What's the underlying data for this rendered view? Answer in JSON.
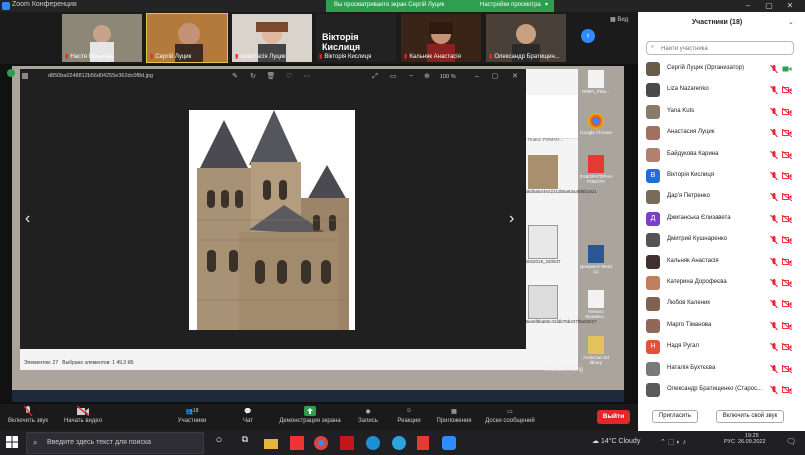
{
  "app": {
    "title": "Zoom Конференция"
  },
  "banner": {
    "viewing": "Вы просматриваете экран Сергій Луцик",
    "options": "Настройки просмотра"
  },
  "thumbnails": [
    {
      "name": "Настя Гуськова"
    },
    {
      "name": "Сергій Луцик"
    },
    {
      "name": "Анастасія Луцик"
    },
    {
      "name": "Вікторія Кислиця",
      "big_label": "Вікторія Кислиця"
    },
    {
      "name": "Кальняк Анастасія"
    },
    {
      "name": "Олександр Братищен..."
    }
  ],
  "view_label": "Вид",
  "photoviewer": {
    "filename": "d850ba0248812b56d04255e362dc0f8d.jpg",
    "zoom": "100 %"
  },
  "explorer": {
    "status_items": "Элементов: 27",
    "status_selected": "Выбрано элементов: 1  49,3 КБ",
    "search_placeholder": "Поиск: РОМАН...",
    "files": [
      {
        "label": "0b63ba524e2221d55a63a48f6b1821"
      },
      {
        "label": "2022019_220047"
      },
      {
        "label": "66a4ef5ba60c41fdb76b437f9a08227"
      }
    ]
  },
  "desktop_icons": [
    {
      "label": "RMIFI_Files..."
    },
    {
      "label": "Google Chrome"
    },
    {
      "label": "ЛАБОРАТОРНА РОБОТА"
    },
    {
      "label": "Документ Word (1)"
    },
    {
      "label": "Начало Маковск..."
    },
    {
      "label": "ArchiCad old library"
    }
  ],
  "bing": "Microsoft Bing",
  "toolbar": {
    "audio": "Включить звук",
    "video": "Начать видео",
    "participants": "Участники",
    "participants_count": "18",
    "chat": "Чат",
    "share": "Демонстрация экрана",
    "record": "Запись",
    "reactions": "Реакции",
    "apps": "Приложения",
    "whiteboard": "Доски сообщений",
    "end": "Выйти"
  },
  "panel": {
    "title": "Участники (18)",
    "search_placeholder": "Найти участника",
    "participants": [
      {
        "name": "Сергій Луцик (Организатор)",
        "initial": "",
        "color": "#6b5b4b"
      },
      {
        "name": "Liza Nazarenko",
        "initial": "",
        "color": "#4a4a4a"
      },
      {
        "name": "Yana Kuts",
        "initial": "",
        "color": "#8a7a6a"
      },
      {
        "name": "Анастасия Луцик",
        "initial": "",
        "color": "#a07060"
      },
      {
        "name": "Байдукова Карина",
        "initial": "",
        "color": "#b08070"
      },
      {
        "name": "Вікторія Кислиця",
        "initial": "В",
        "color": "#1E6FD9"
      },
      {
        "name": "Дар'я Петренко",
        "initial": "",
        "color": "#7a6a5a"
      },
      {
        "name": "Джиганська Єлизавета",
        "initial": "Д",
        "color": "#7B3FC4"
      },
      {
        "name": "Дмитрий Кушнаренко",
        "initial": "",
        "color": "#555"
      },
      {
        "name": "Кальняк Анастасія",
        "initial": "",
        "color": "#403030"
      },
      {
        "name": "Катерина Дорофеєва",
        "initial": "",
        "color": "#c08060"
      },
      {
        "name": "Любов Каленик",
        "initial": "",
        "color": "#806050"
      },
      {
        "name": "Марго Тіманова",
        "initial": "",
        "color": "#906858"
      },
      {
        "name": "Надя Ругал",
        "initial": "Н",
        "color": "#E0533A"
      },
      {
        "name": "Наталія Бухтєєва",
        "initial": "",
        "color": "#7a7a7a"
      },
      {
        "name": "Олександр Братищенко (Старос...",
        "initial": "",
        "color": "#5a5a5a"
      }
    ],
    "invite": "Пригласить",
    "unmute_me": "Включить свой звук"
  },
  "taskbar": {
    "search_placeholder": "Введите здесь текст для поиска",
    "weather": "14°C  Cloudy",
    "lang": "РУС",
    "time": "19:25",
    "date": "26.09.2022"
  }
}
